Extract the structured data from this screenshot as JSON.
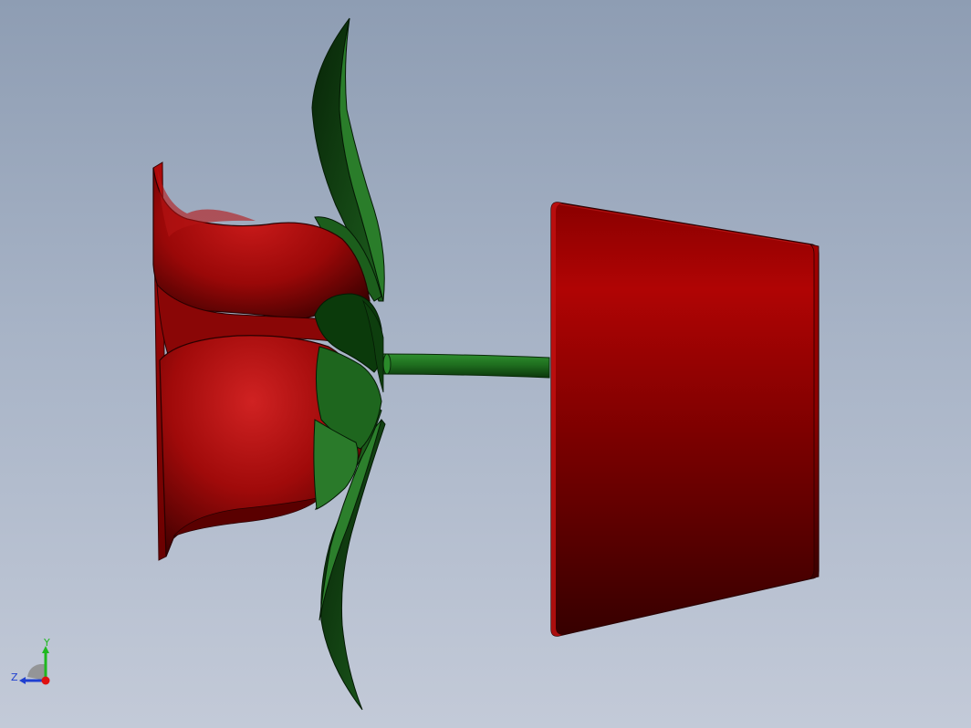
{
  "viewport": {
    "background_top": "#8e9db3",
    "background_bottom": "#c3cad8"
  },
  "model": {
    "parts": [
      "rose-bloom",
      "sepals",
      "stem",
      "pot"
    ],
    "colors": {
      "petal": "#a10d0d",
      "petal_dark": "#3d0000",
      "leaf": "#1f6b1f",
      "leaf_dark": "#0a2e0a",
      "pot": "#9c0000",
      "pot_dark": "#3a0000"
    }
  },
  "triad": {
    "y_label": "Y",
    "z_label": "Z",
    "colors": {
      "y": "#1fb81f",
      "z": "#1f3fd0",
      "x": "#e01010"
    }
  }
}
